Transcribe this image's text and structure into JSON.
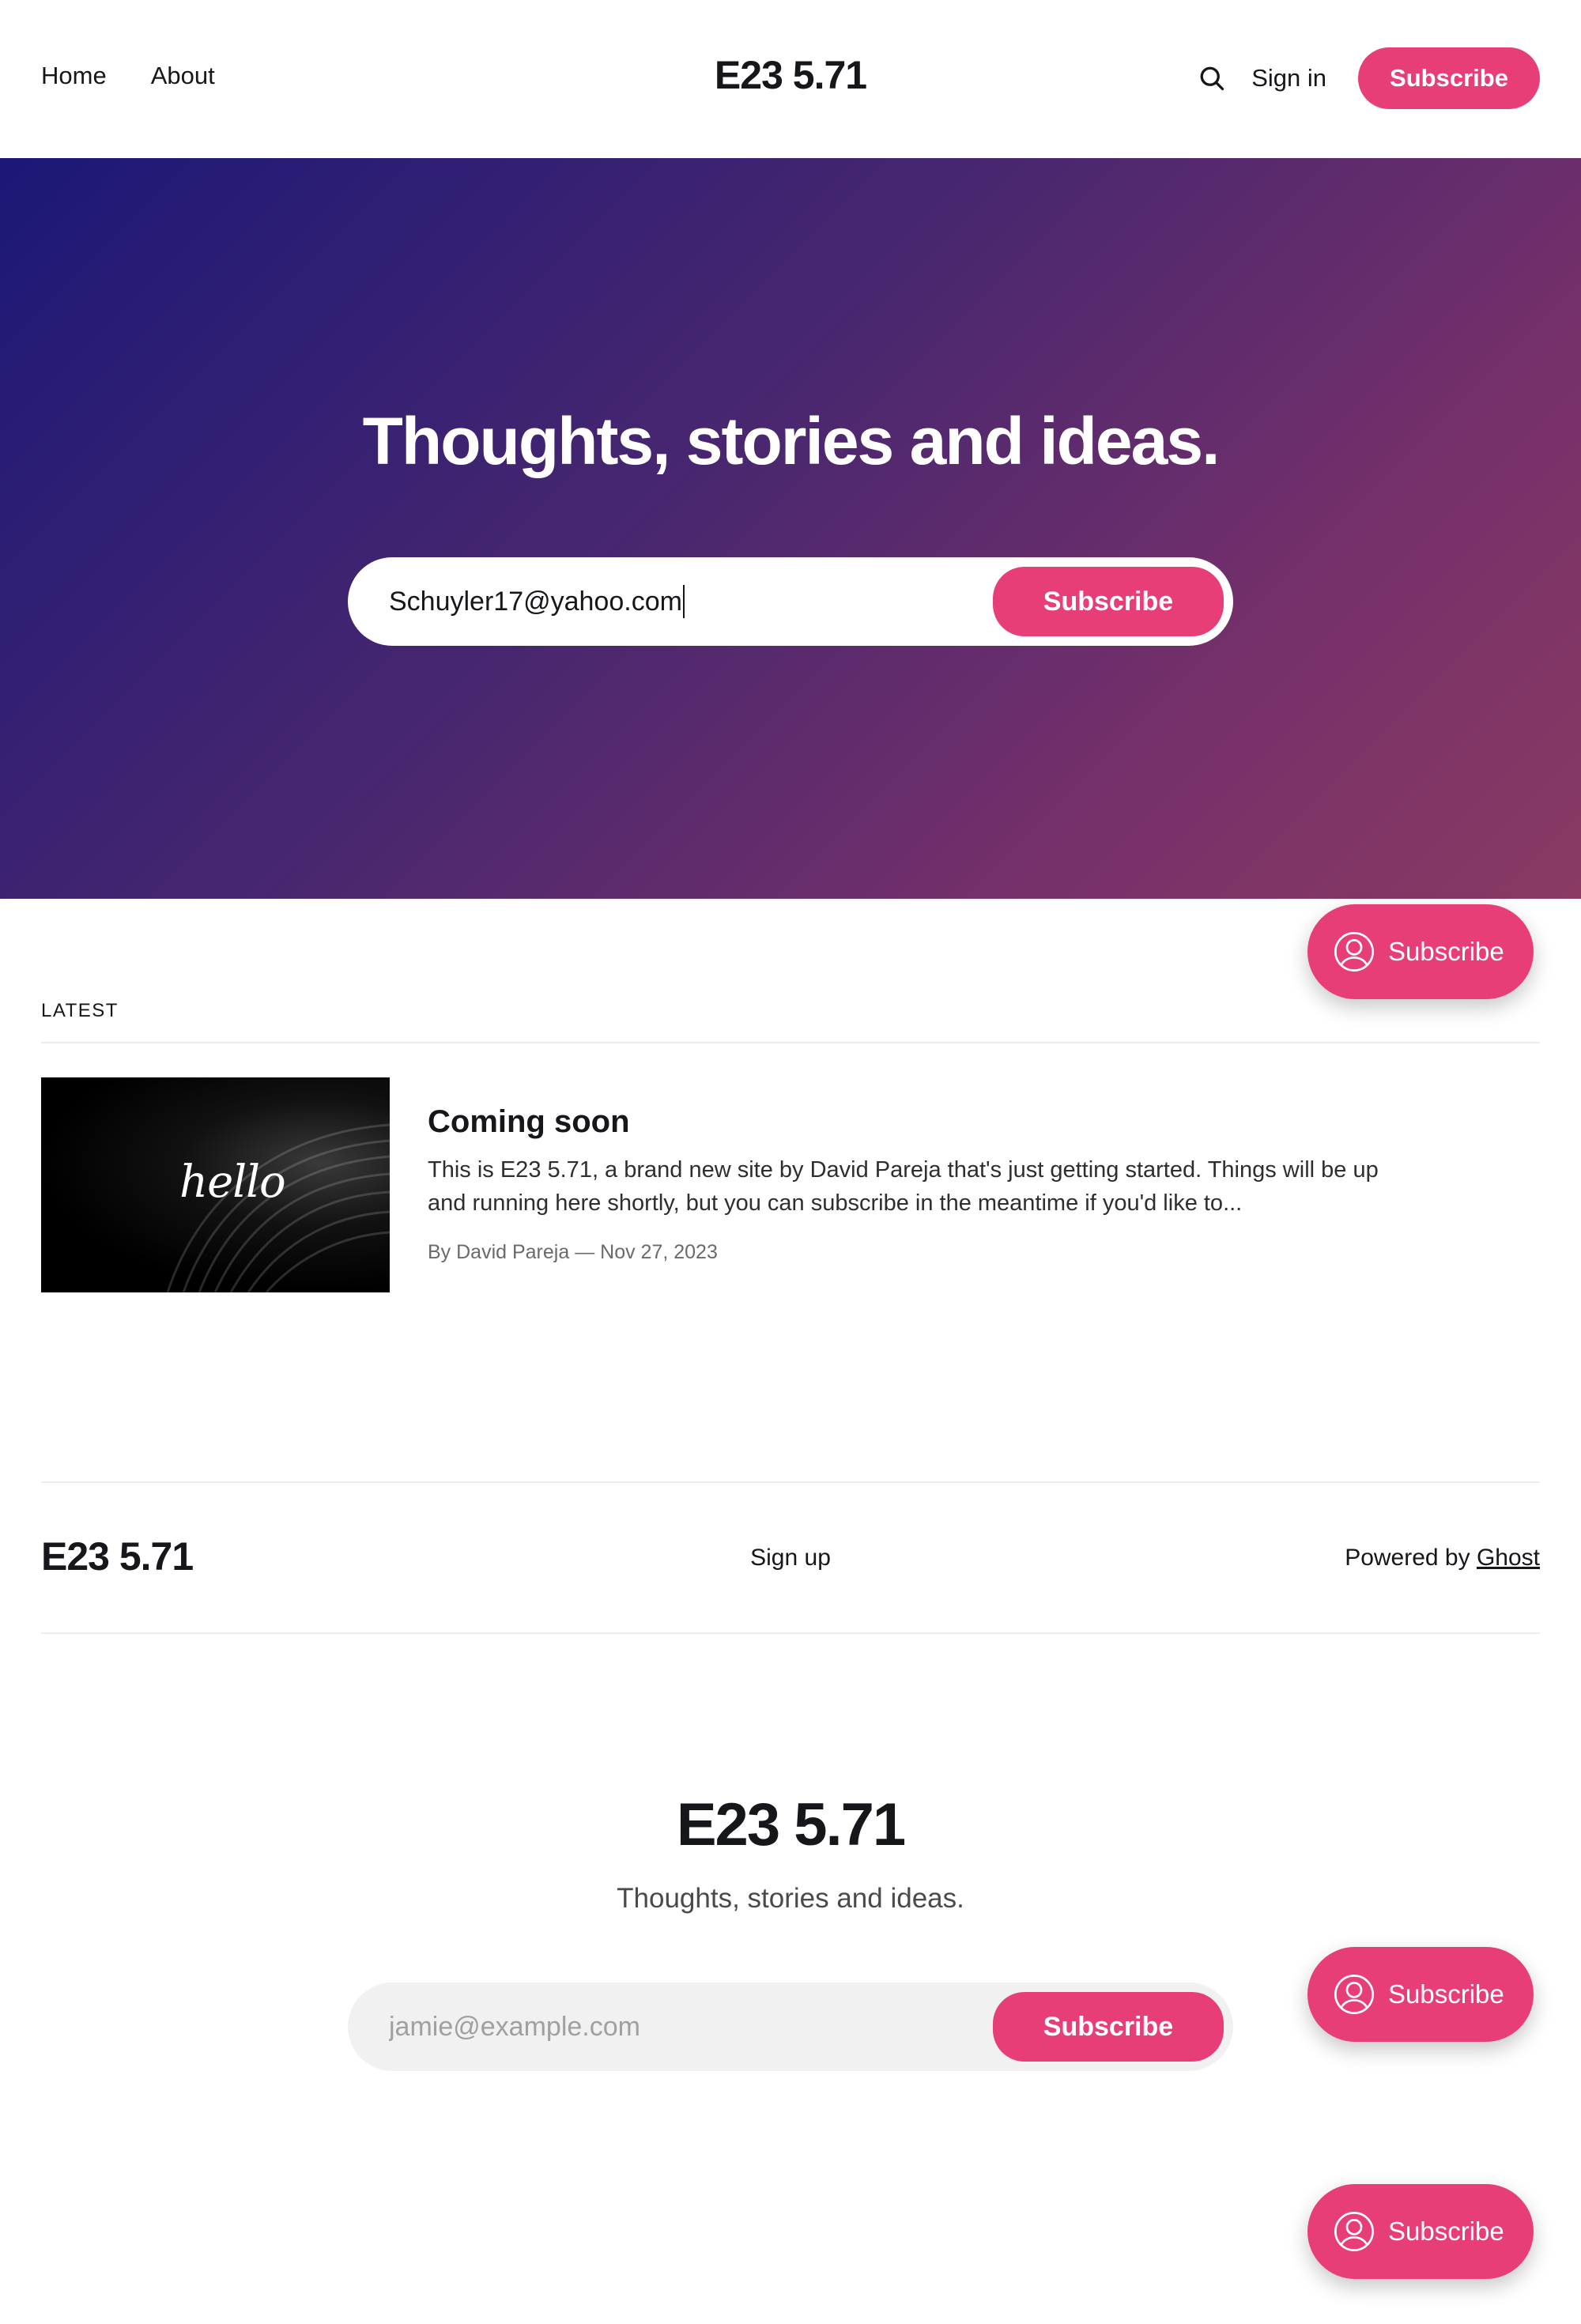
{
  "header": {
    "nav": [
      {
        "label": "Home"
      },
      {
        "label": "About"
      }
    ],
    "site_title": "E23 5.71",
    "signin_label": "Sign in",
    "subscribe_label": "Subscribe",
    "search_icon": "search-icon"
  },
  "hero": {
    "title": "Thoughts, stories and ideas.",
    "email_value": "Schuyler17@yahoo.com",
    "subscribe_label": "Subscribe"
  },
  "portal": {
    "label": "Subscribe",
    "icon": "user-circle-icon"
  },
  "latest": {
    "label": "LATEST",
    "post": {
      "thumb_text": "hello",
      "title": "Coming soon",
      "excerpt": "This is E23 5.71, a brand new site by David Pareja that's just getting started. Things will be up and running here shortly, but you can subscribe in the meantime if you'd like to...",
      "meta": "By David Pareja — Nov 27, 2023"
    }
  },
  "footer": {
    "site_title": "E23 5.71",
    "signup_label": "Sign up",
    "powered_prefix": "Powered by ",
    "powered_link": "Ghost"
  },
  "cta": {
    "title": "E23 5.71",
    "subtitle": "Thoughts, stories and ideas.",
    "email_placeholder": "jamie@example.com",
    "subscribe_label": "Subscribe"
  },
  "colors": {
    "accent": "#e83e78",
    "text": "#15171a",
    "hero_gradient_start": "#1b1877",
    "hero_gradient_end": "#8a3a63"
  }
}
